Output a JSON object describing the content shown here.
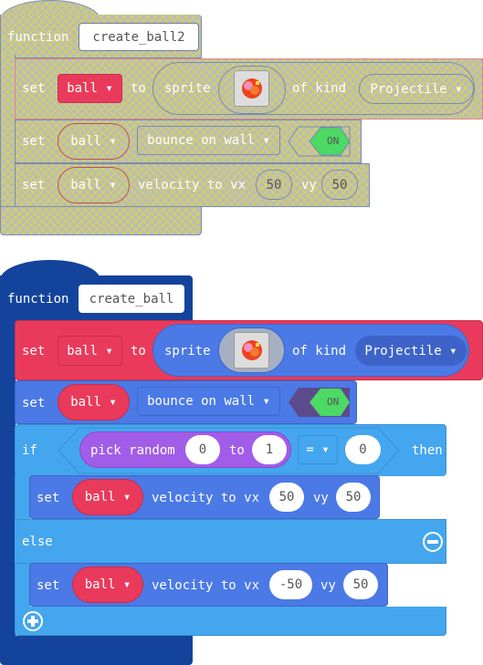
{
  "disabled_function": {
    "keyword": "function",
    "name": "create_ball2",
    "set_sprite": {
      "set": "set",
      "var": "ball ▾",
      "to": "to",
      "sprite": "sprite",
      "of_kind": "of kind",
      "kind": "Projectile ▾"
    },
    "set_flag": {
      "set": "set",
      "var": "ball ▾",
      "flag": "bounce on wall ▾",
      "toggle": "ON"
    },
    "set_velocity": {
      "set": "set",
      "var": "ball ▾",
      "label": "velocity to vx",
      "vx": "50",
      "vy_label": "vy",
      "vy": "50"
    }
  },
  "function": {
    "keyword": "function",
    "name": "create_ball",
    "set_sprite": {
      "set": "set",
      "var": "ball ▾",
      "to": "to",
      "sprite": "sprite",
      "of_kind": "of kind",
      "kind": "Projectile ▾"
    },
    "set_flag": {
      "set": "set",
      "var": "ball ▾",
      "flag": "bounce on wall ▾",
      "toggle": "ON"
    },
    "if_block": {
      "if": "if",
      "pick": "pick random",
      "from": "0",
      "to": "to",
      "max": "1",
      "op": "= ▾",
      "compare": "0",
      "then": "then",
      "else": "else",
      "then_stmt": {
        "set": "set",
        "var": "ball ▾",
        "label": "velocity to vx",
        "vx": "50",
        "vy_label": "vy",
        "vy": "50"
      },
      "else_stmt": {
        "set": "set",
        "var": "ball ▾",
        "label": "velocity to vx",
        "vx": "-50",
        "vy_label": "vy",
        "vy": "50"
      }
    }
  },
  "colors": {
    "set_var": "#ea3a5b",
    "sprites": "#4b79e6",
    "logic": "#44a6ef",
    "math": "#a25de8",
    "functions": "#14439b",
    "toggle_on": "#4cd964"
  }
}
